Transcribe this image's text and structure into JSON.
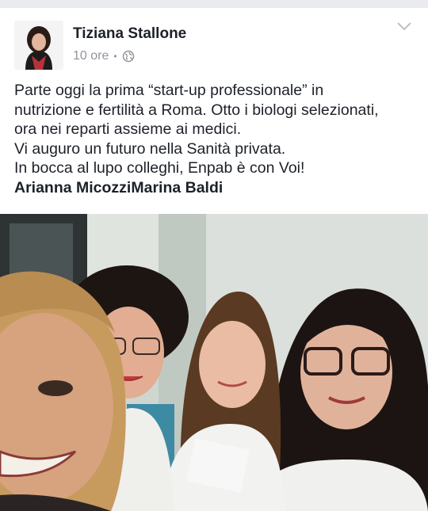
{
  "post": {
    "author": "Tiziana Stallone",
    "time": "10 ore",
    "separator": "•",
    "privacy_icon": "globe-icon",
    "menu_icon": "chevron-down-icon",
    "text_lines": [
      "Parte oggi la prima “start-up professionale” in",
      "nutrizione e fertilità a Roma. Otto i biologi selezionati,",
      "ora nei reparti assieme ai medici.",
      "Vi auguro un futuro nella Sanità privata.",
      "In bocca al lupo colleghi, Enpab è con Voi!"
    ],
    "tagged": [
      "Arianna Micozzi",
      "Marina Baldi"
    ]
  },
  "colors": {
    "text": "#1d2129",
    "meta": "#90949c",
    "top_strip": "#e9ebee"
  }
}
